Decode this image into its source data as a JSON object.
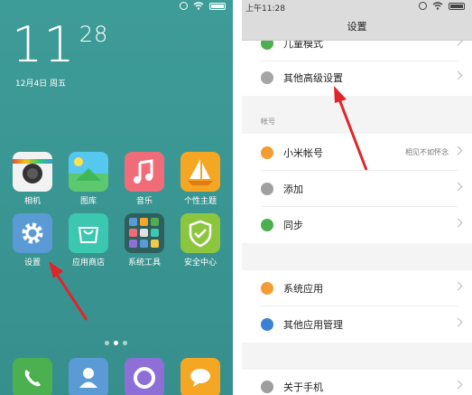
{
  "home": {
    "clock_hours": "11",
    "clock_minutes": "28",
    "date": "12月4日 周五",
    "apps": [
      {
        "label": "相机",
        "icon": "camera-icon"
      },
      {
        "label": "图库",
        "icon": "gallery-icon"
      },
      {
        "label": "音乐",
        "icon": "music-icon"
      },
      {
        "label": "个性主题",
        "icon": "themes-icon"
      },
      {
        "label": "设置",
        "icon": "settings-gear-icon"
      },
      {
        "label": "应用商店",
        "icon": "app-store-icon"
      },
      {
        "label": "系统工具",
        "icon": "system-tools-folder-icon"
      },
      {
        "label": "安全中心",
        "icon": "security-center-icon"
      }
    ],
    "dock": [
      {
        "icon": "phone-icon"
      },
      {
        "icon": "contacts-icon"
      },
      {
        "icon": "browser-icon"
      },
      {
        "icon": "messages-icon"
      }
    ],
    "page_dots": 3,
    "active_dot": 1
  },
  "settings": {
    "status_time": "上午11:28",
    "title": "设置",
    "rows": [
      {
        "label": "儿童模式",
        "icon": "child-mode-icon",
        "color": "#4caf50"
      },
      {
        "label": "其他高级设置",
        "icon": "more-settings-icon",
        "color": "#9e9e9e"
      },
      {
        "label": "小米帐号",
        "icon": "mi-account-icon",
        "color": "#f39c34",
        "value": "相见不如怀念"
      },
      {
        "label": "添加",
        "icon": "add-icon",
        "color": "#a0a0a0"
      },
      {
        "label": "同步",
        "icon": "sync-icon",
        "color": "#4caf50"
      },
      {
        "label": "系统应用",
        "icon": "system-apps-icon",
        "color": "#f39c34"
      },
      {
        "label": "其他应用管理",
        "icon": "other-apps-icon",
        "color": "#3b82d6"
      },
      {
        "label": "关于手机",
        "icon": "about-phone-icon",
        "color": "#9e9e9e"
      }
    ],
    "section_account": "帐号"
  },
  "colors": {
    "wallpaper": "#3a9794",
    "arrow": "#e0252a"
  }
}
